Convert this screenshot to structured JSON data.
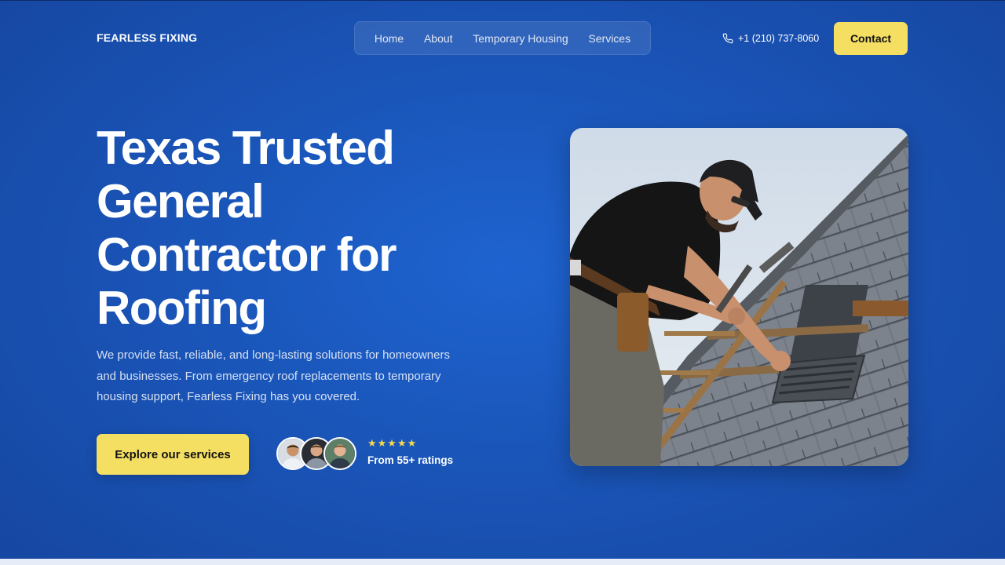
{
  "header": {
    "brand": "FEARLESS FIXING",
    "nav": [
      "Home",
      "About",
      "Temporary Housing",
      "Services"
    ],
    "phone": "+1 (210) 737-8060",
    "phone_icon": "phone-icon",
    "contact_label": "Contact"
  },
  "hero": {
    "headline_lines": [
      "Texas Trusted",
      "General",
      "Contractor for",
      "Roofing"
    ],
    "description": "We provide fast, reliable, and long-lasting solutions for homeowners and businesses. From emergency roof replacements to temporary housing support, Fearless Fixing has you covered.",
    "cta_label": "Explore our services",
    "rating_stars": "★★★★★",
    "rating_value": 5,
    "ratings_text": "From 55+ ratings"
  },
  "colors": {
    "hero_bg": "#1a55b8",
    "accent_yellow": "#f5df63",
    "star": "#f5d84e",
    "text": "#ffffff"
  }
}
